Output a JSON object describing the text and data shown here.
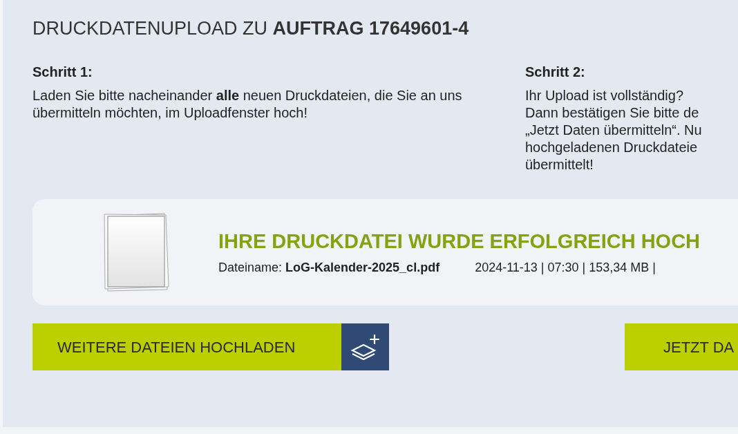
{
  "title": "DRUCKDATENUPLOAD ZU **AUFTRAG 17649601-4**",
  "steps": [
    {
      "heading": "Schritt 1:",
      "lines": [
        "Laden Sie bitte nacheinander **alle** neuen Druckdateien, die Sie an uns übermitteln möchten, im Uploadfenster hoch!"
      ]
    },
    {
      "heading": "Schritt 2:",
      "lines": [
        "Ihr Upload ist vollständig?",
        "Dann bestätigen Sie bitte de",
        "„Jetzt Daten übermitteln“. Nu",
        "hochgeladenen Druckdateie",
        "übermittelt!"
      ]
    }
  ],
  "upload_card": {
    "heading": "IHRE DRUCKDATEI WURDE ERFOLGREICH HOCH",
    "filename_label": "Dateiname:",
    "filename": "LoG-Kalender-2025_cl.pdf",
    "meta": "2024-11-13 | 07:30 | 153,34 MB |"
  },
  "buttons": [
    {
      "label": "WEITERE DATEIEN HOCHLADEN",
      "kind": "upload"
    },
    {
      "label": "JETZT DA",
      "kind": "submit"
    }
  ]
}
